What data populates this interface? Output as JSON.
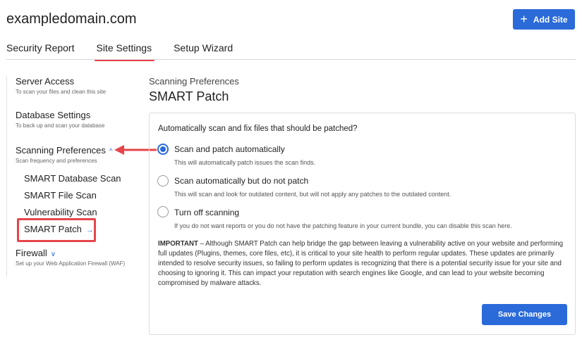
{
  "header": {
    "domain": "exampledomain.com",
    "add_site_label": "Add Site",
    "add_site_icon": "plus-icon"
  },
  "tabs": [
    {
      "label": "Security Report",
      "active": false
    },
    {
      "label": "Site Settings",
      "active": true
    },
    {
      "label": "Setup Wizard",
      "active": false
    }
  ],
  "sidebar": {
    "items": [
      {
        "title": "Server Access",
        "desc": "To scan your files and clean this site"
      },
      {
        "title": "Database Settings",
        "desc": "To back up and scan your database"
      },
      {
        "title": "Scanning Preferences",
        "desc": "Scan frequency and preferences",
        "chevron": "^",
        "expanded": true
      },
      {
        "title": "Firewall",
        "desc": "Set up your Web Application Firewall (WAF)",
        "chevron": "∨",
        "expanded": false
      }
    ],
    "subitems": [
      {
        "label": "SMART Database Scan"
      },
      {
        "label": "SMART File Scan"
      },
      {
        "label": "Vulnerability Scan"
      },
      {
        "label": "SMART Patch",
        "arrow": "→",
        "active": true
      }
    ]
  },
  "main": {
    "section_label": "Scanning Preferences",
    "title": "SMART Patch",
    "question": "Automatically scan and fix files that should be patched?",
    "options": [
      {
        "label": "Scan and patch automatically",
        "desc": "This will automatically patch issues the scan finds.",
        "checked": true
      },
      {
        "label": "Scan automatically but do not patch",
        "desc": "This will scan and look for outdated content, but will not apply any patches to the outdated content.",
        "checked": false
      },
      {
        "label": "Turn off scanning",
        "desc": "If you do not want reports or you do not have the patching feature in your current bundle, you can disable this scan here.",
        "checked": false
      }
    ],
    "important_prefix": "IMPORTANT",
    "important_text": " – Although SMART Patch can help bridge the gap between leaving a vulnerability active on your website and performing full updates (Plugins, themes, core files, etc), it is critical to your site health to perform regular updates. These updates are primarily intended to resolve security issues, so failing to perform updates is recognizing that there is a potential security issue for your site and choosing to ignoring it. This can impact your reputation with search engines like Google, and can lead to your website becoming compromised by malware attacks.",
    "save_label": "Save Changes"
  },
  "colors": {
    "accent": "#2a6ad9",
    "annotation_red": "#e5454b"
  }
}
